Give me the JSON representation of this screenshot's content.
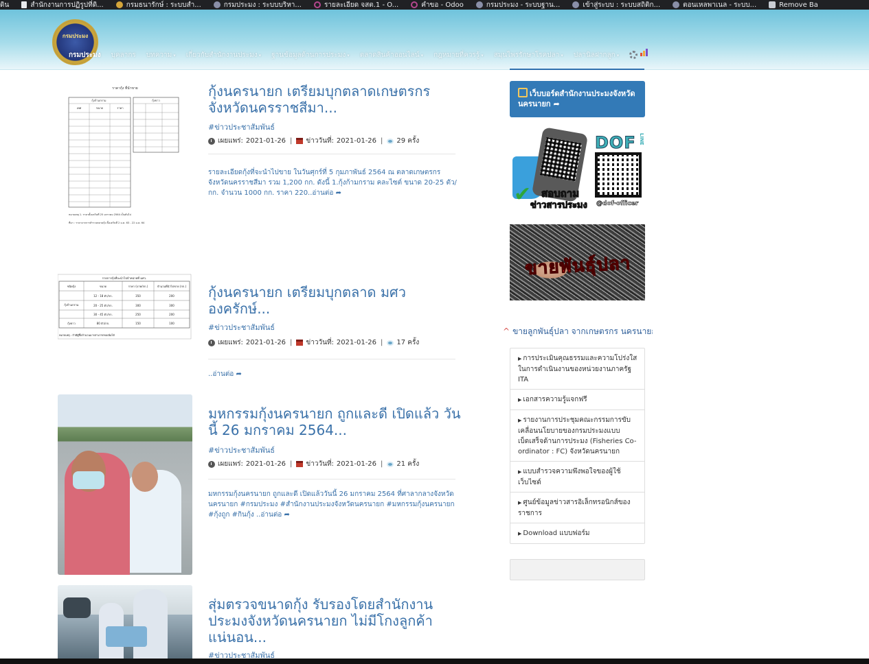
{
  "bookmarks": [
    {
      "label": "ดิน",
      "icon": "none"
    },
    {
      "label": "สำนักงานการปฏิรูปที่ดิ...",
      "icon": "page-icon"
    },
    {
      "label": "กรมธนารักษ์ : ระบบสำ...",
      "icon": "seal-icon"
    },
    {
      "label": "กรมประมง : ระบบบริหา...",
      "icon": "seal-icon"
    },
    {
      "label": "รายละเอียด จสต.1 - O...",
      "icon": "odoo-icon"
    },
    {
      "label": "คำขอ - Odoo",
      "icon": "odoo-icon"
    },
    {
      "label": "กรมประมง - ระบบฐาน...",
      "icon": "seal-icon"
    },
    {
      "label": "เข้าสู่ระบบ : ระบบสถิติก...",
      "icon": "seal-icon"
    },
    {
      "label": "ตอนเหลพาเนล - ระบบ...",
      "icon": "seal-icon"
    },
    {
      "label": "Remove Ba",
      "icon": "layers-icon"
    }
  ],
  "header": {
    "logo_text": "กรมประมง",
    "nav": [
      {
        "label": "กรมประมง",
        "caret": false,
        "active": true
      },
      {
        "label": "บุคลากร",
        "caret": false,
        "active": false
      },
      {
        "label": "บทความ",
        "caret": true,
        "active": false
      },
      {
        "label": "เกี่ยวกับสำนักงานประมง",
        "caret": true,
        "active": false
      },
      {
        "label": "ฐานข้อมูลด้านการประมง",
        "caret": true,
        "active": false
      },
      {
        "label": "ตลาดสินค้าออนไลน์",
        "caret": true,
        "active": false
      },
      {
        "label": "กฎหมายที่ควรรู้",
        "caret": true,
        "active": false
      },
      {
        "label": "สมุนไพรรักษาโรคปลา",
        "caret": true,
        "active": false
      },
      {
        "label": "ปลานิลฝากลูก",
        "caret": true,
        "active": false
      }
    ]
  },
  "articles": [
    {
      "title": "กุ้งนครนายก เตรียมบุกตลาดเกษตรกร จังหวัดนครราชสีมา...",
      "category": "#ข่าวประชาสัมพันธ์",
      "published_label": "เผยแพร่:",
      "published": "2021-01-26",
      "news_date_label": "ข่าววันที่:",
      "news_date": "2021-01-26",
      "views": "29 ครั้ง",
      "excerpt": "รายละเอียดกุ้งที่จะนำไปขาย ในวันศุกร์ที่ 5 กุมภาพันธ์ 2564 ณ ตลาดเกษตรกร จังหวัดนครราชสีมา รวม 1,200 กก. ดังนี้ 1.กุ้งก้ามกราม คละไซต์ ขนาด 20-25 ตัว/กก. จำนวน 1000 กก. ราคา 220..",
      "read_more": "อ่านต่อ"
    },
    {
      "title": "กุ้งนครนายก เตรียมบุกตลาด มศว องครักษ์...",
      "category": "#ข่าวประชาสัมพันธ์",
      "published_label": "เผยแพร่:",
      "published": "2021-01-26",
      "news_date_label": "ข่าววันที่:",
      "news_date": "2021-01-26",
      "views": "17 ครั้ง",
      "excerpt": "..",
      "read_more": "อ่านต่อ"
    },
    {
      "title": "มหกรรมกุ้งนครนายก ถูกและดี เปิดแล้ว วันนี้ 26 มกราคม 2564...",
      "category": "#ข่าวประชาสัมพันธ์",
      "published_label": "เผยแพร่:",
      "published": "2021-01-26",
      "news_date_label": "ข่าววันที่:",
      "news_date": "2021-01-26",
      "views": "21 ครั้ง",
      "excerpt": "มหกรรมกุ้งนครนายก ถูกและดี เปิดแล้ววันนี้ 26 มกราคม 2564 ที่ศาลากลางจังหวัดนครนายก #กรมประมง #สำนักงานประมงจังหวัดนครนายก #มหกรรมกุ้งนครนายก #กุ้งถูก #กินกุ้ง ..",
      "read_more": "อ่านต่อ"
    },
    {
      "title": "สุ่มตรวจขนาดกุ้ง รับรองโดยสำนักงานประมงจังหวัดนครนายก ไม่มีโกงลูกค้า แน่นอน...",
      "category": "#ข่าวประชาสัมพันธ์"
    }
  ],
  "thumb1": {
    "heading": "ราคากุ้ง ที่นำขาย",
    "left_head": "กุ้งก้ามกราม",
    "right_head": "กุ้งขาว",
    "cols": [
      "เพศ",
      "ขนาด",
      "ราคา"
    ],
    "note1": "หมายเหตุ 1. ราคาตั้งแต่วันที่ 25 มกราคม 2564 เป็นต้นไป",
    "note2": "ที่มา : ราคาจากการสำรวจตลาดกุ้ง ตั้งแต่วันที่ 2 ม.ค. 63 - 22 ม.ค. 64"
  },
  "thumb2": {
    "heading": "รายการกุ้งที่จะนำไปจำหน่ายที่ มศว.",
    "cols": [
      "ชนิดกุ้ง",
      "ขนาด",
      "ราคา (บาท/กก.)",
      "จำนวนที่นำไปขาย (กก.)"
    ],
    "rows": [
      [
        "กุ้งก้ามกราม",
        "12 - 18 ตัว/กก.",
        "350",
        "200"
      ],
      [
        "",
        "20 - 25 ตัว/กก.",
        "300",
        "300"
      ],
      [
        "",
        "30 - 45 ตัว/กก.",
        "250",
        "200"
      ],
      [
        "กุ้งขาว",
        "80 ตัว/กก.",
        "150",
        "100"
      ]
    ],
    "note": "หมายเหตุ : ถ้ามีผู้ซื้อจำนวนมากสามารถขอเพิ่มได้"
  },
  "sidebar": {
    "board_label": "เว็บบอร์ดสำนักงานประมงจังหวัดนครนายก",
    "dof_brand": "DOF",
    "dof_line": "LINE",
    "dof_ask": "สอบถาม",
    "dof_news": "ข่าวสารประมง",
    "dof_handle": "@dof-officer",
    "fish_sale_text": "ขายพันธุ์ปลา",
    "heading": "ขายลูกพันธุ์ปลา จากเกษตรกร นครนายก",
    "links": [
      "การประเมินคุณธรรมและความโปร่งใสในการดำเนินงานของหน่วยงานภาครัฐ ITA",
      "เอกสารความรู้แจกฟรี",
      "รายงานการประชุมคณะกรรมการขับเคลื่อนนโยบายของกรมประมงแบบเบ็ดเสร็จด้านการประมง (Fisheries Co-ordinator : FC) จังหวัดนครนายก",
      "แบบสำรวจความพึงพอใจของผู้ใช้เว็บไซต์",
      "ศูนย์ข้อมูลข่าวสารอิเล็กทรอนิกส์ของราชการ",
      "Download แบบฟอร์ม"
    ]
  },
  "colors": {
    "link": "#3a71a9",
    "board_bg": "#337ab7",
    "header_top": "#6fc3dc",
    "fish_text": "#d41b1b"
  }
}
